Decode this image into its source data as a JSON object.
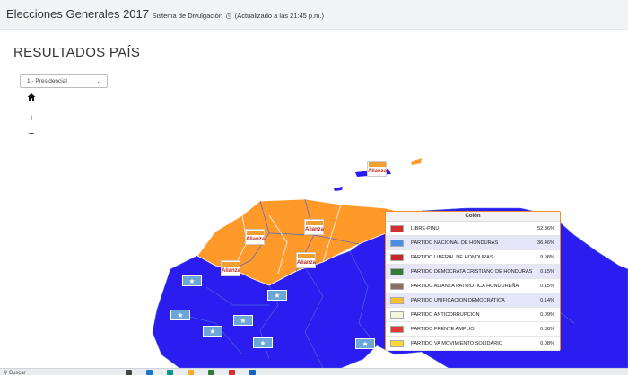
{
  "header": {
    "title": "Elecciones Generales 2017",
    "system": "Sistema de Divulgación",
    "updated": "(Actualizado a las 21:45 p.m.)"
  },
  "page": {
    "title": "RESULTADOS PAÍS"
  },
  "election_select": {
    "value": "1 - Presidencial"
  },
  "map_controls": {
    "home_icon": "home-icon",
    "zoom_in": "+",
    "zoom_out": "−"
  },
  "map": {
    "colors": {
      "orange": "#ff9a2a",
      "blue": "#2b1cf0",
      "marker_blue": "#6aa6d8"
    },
    "marker_labels": {
      "alianza": "Alianza"
    }
  },
  "results_panel": {
    "department": "Colón",
    "rows": [
      {
        "party": "LIBRE-PINU",
        "pct": "52.86%",
        "flag_color": "#d32f2f"
      },
      {
        "party": "PARTIDO NACIONAL DE HONDURAS",
        "pct": "36.46%",
        "flag_color": "#4a90e2"
      },
      {
        "party": "PARTIDO LIBERAL DE HONDURAS",
        "pct": "9.98%",
        "flag_color": "#c62828"
      },
      {
        "party": "PARTIDO DEMOCRATA CRISTIANO DE HONDURAS",
        "pct": "0.15%",
        "flag_color": "#2e7d32"
      },
      {
        "party": "PARTIDO ALIANZA PATRIOTICA HONDUREÑA",
        "pct": "0.15%",
        "flag_color": "#8d6e63"
      },
      {
        "party": "PARTIDO UNIFICACION DEMOCRATICA",
        "pct": "0.14%",
        "flag_color": "#fbc02d"
      },
      {
        "party": "PARTIDO ANTICORRUPCION",
        "pct": "0.09%",
        "flag_color": "#f5f5dc"
      },
      {
        "party": "PARTIDO FRENTE AMPLIO",
        "pct": "0.08%",
        "flag_color": "#e53935"
      },
      {
        "party": "PARTIDO VA MOVIMIENTO SOLIDARIO",
        "pct": "0.08%",
        "flag_color": "#fdd835"
      }
    ]
  },
  "taskbar": {
    "search_label": "Buscar"
  }
}
